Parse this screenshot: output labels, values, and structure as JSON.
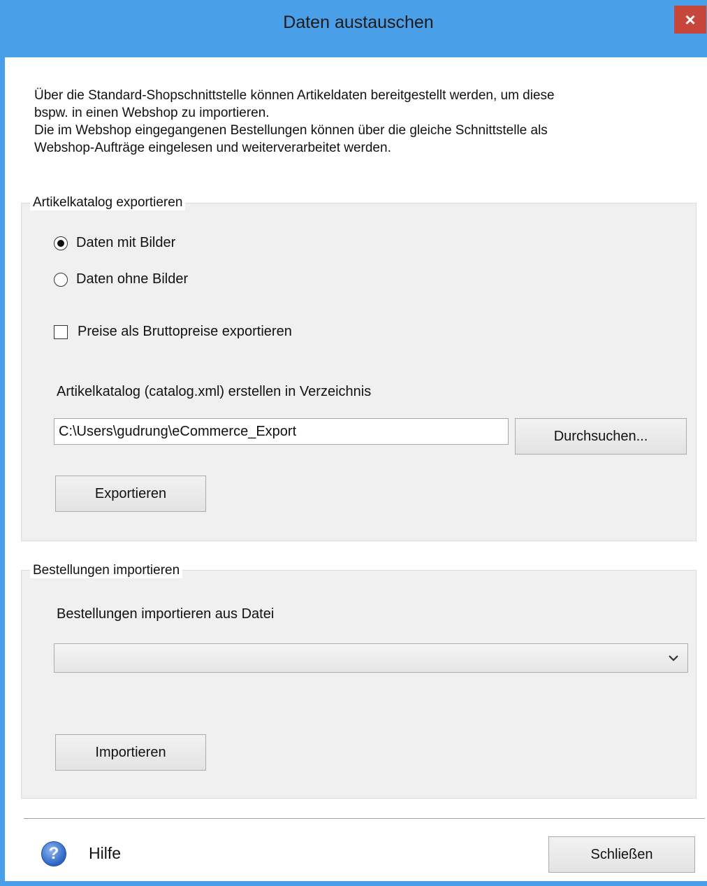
{
  "window": {
    "title": "Daten austauschen",
    "close_glyph": "×"
  },
  "intro_text": "Über die Standard-Shopschnittstelle können Artikeldaten bereitgestellt werden, um diese\nbspw. in einen Webshop zu importieren.\nDie im Webshop eingegangenen Bestellungen können über die gleiche Schnittstelle  als\nWebshop-Aufträge eingelesen und weiterverarbeitet werden.",
  "export_group": {
    "legend": "Artikelkatalog exportieren",
    "radio_with_images": {
      "label": "Daten mit Bilder",
      "checked": true
    },
    "radio_without_images": {
      "label": "Daten ohne Bilder",
      "checked": false
    },
    "gross_prices_checkbox": {
      "label": "Preise als Bruttopreise exportieren",
      "checked": false
    },
    "directory_label": "Artikelkatalog (catalog.xml) erstellen in Verzeichnis",
    "directory_value": "C:\\Users\\gudrung\\eCommerce_Export",
    "browse_button": "Durchsuchen...",
    "export_button": "Exportieren"
  },
  "import_group": {
    "legend": "Bestellungen importieren",
    "file_label": "Bestellungen importieren aus Datei",
    "file_dropdown_value": "",
    "import_button": "Importieren"
  },
  "footer": {
    "help_icon": "help-icon",
    "help_label": "Hilfe",
    "close_button": "Schließen"
  },
  "colors": {
    "titlebar": "#4aa0e8",
    "close_button": "#c7463c",
    "group_background": "#f0f0f0"
  }
}
